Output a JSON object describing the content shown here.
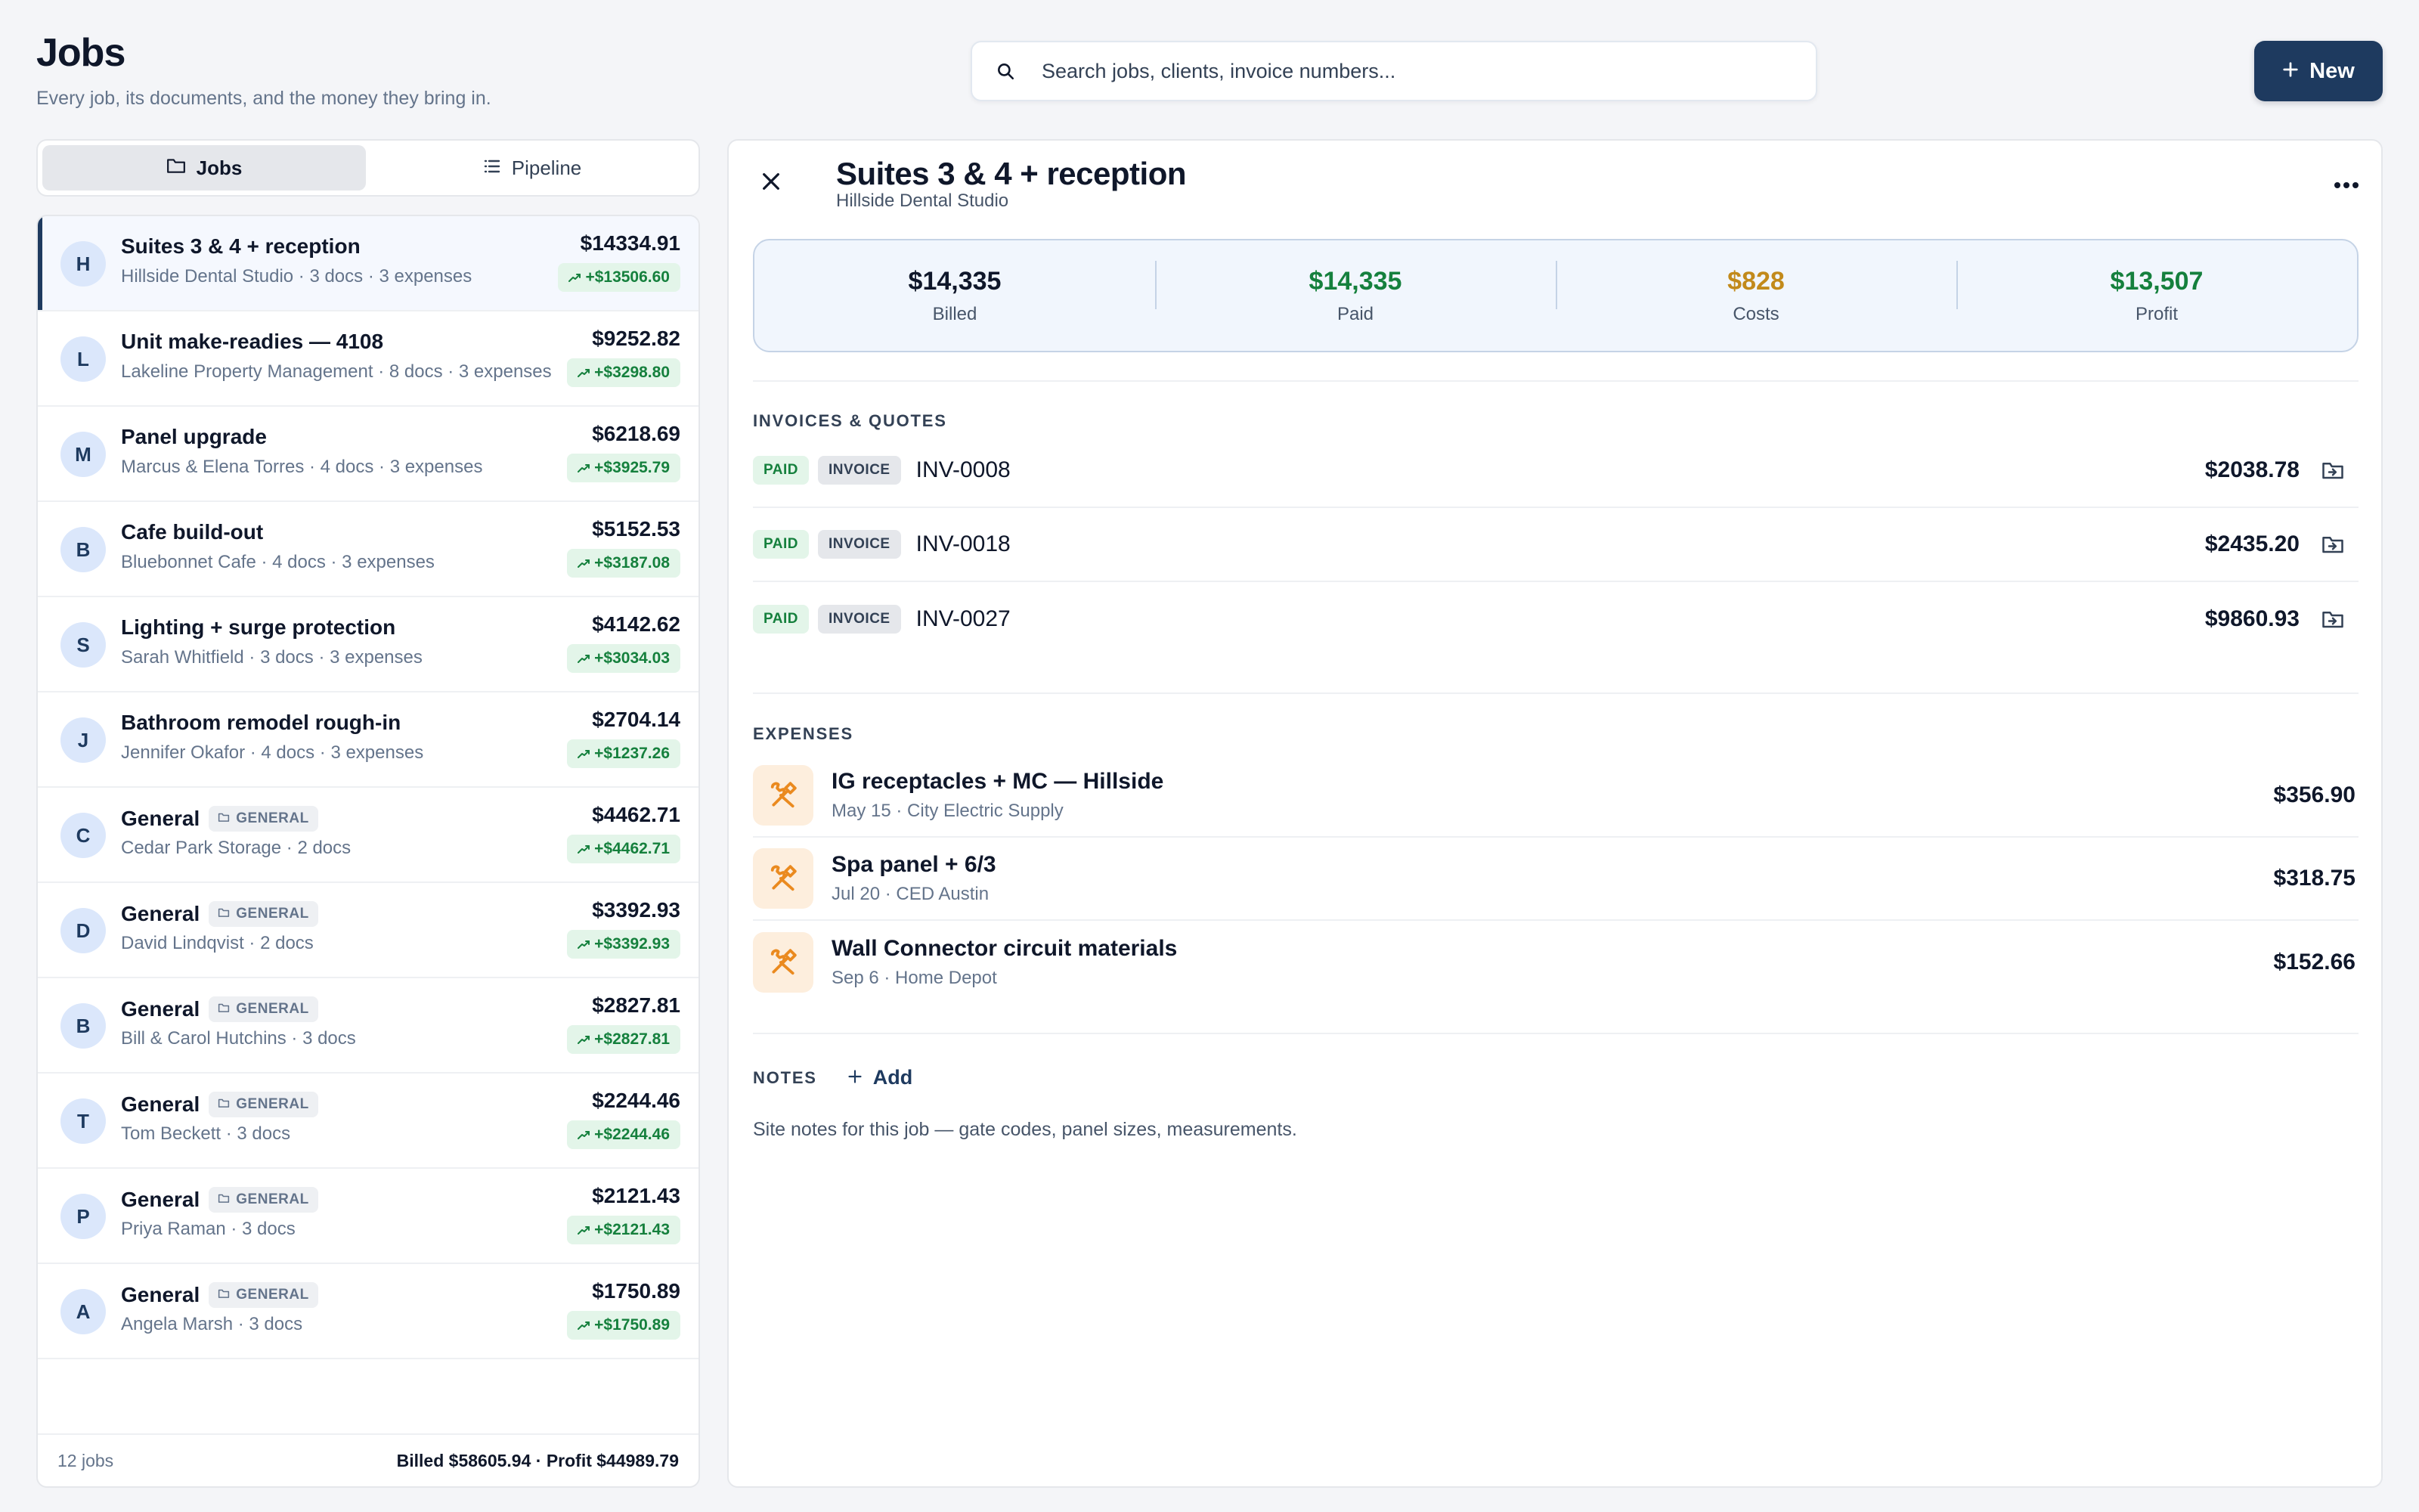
{
  "header": {
    "title": "Jobs",
    "subtitle": "Every job, its documents, and the money they bring in.",
    "search_placeholder": "Search jobs, clients, invoice numbers...",
    "new_label": "New"
  },
  "tabs": [
    {
      "label": "Jobs",
      "active": true,
      "icon": "folder-icon"
    },
    {
      "label": "Pipeline",
      "active": false,
      "icon": "list-icon"
    }
  ],
  "jobs": [
    {
      "initial": "H",
      "title": "Suites 3 & 4 + reception",
      "general": false,
      "sub": "Hillside Dental Studio · 3 docs · 3 expenses",
      "amount": "$14334.91",
      "profit": "+$13506.60",
      "selected": true
    },
    {
      "initial": "L",
      "title": "Unit make-readies — 4108",
      "general": false,
      "sub": "Lakeline Property Management · 8 docs · 3 expenses",
      "amount": "$9252.82",
      "profit": "+$3298.80"
    },
    {
      "initial": "M",
      "title": "Panel upgrade",
      "general": false,
      "sub": "Marcus & Elena Torres · 4 docs · 3 expenses",
      "amount": "$6218.69",
      "profit": "+$3925.79"
    },
    {
      "initial": "B",
      "title": "Cafe build-out",
      "general": false,
      "sub": "Bluebonnet Cafe · 4 docs · 3 expenses",
      "amount": "$5152.53",
      "profit": "+$3187.08"
    },
    {
      "initial": "S",
      "title": "Lighting + surge protection",
      "general": false,
      "sub": "Sarah Whitfield · 3 docs · 3 expenses",
      "amount": "$4142.62",
      "profit": "+$3034.03"
    },
    {
      "initial": "J",
      "title": "Bathroom remodel rough-in",
      "general": false,
      "sub": "Jennifer Okafor · 4 docs · 3 expenses",
      "amount": "$2704.14",
      "profit": "+$1237.26"
    },
    {
      "initial": "C",
      "title": "General",
      "general": true,
      "sub": "Cedar Park Storage · 2 docs",
      "amount": "$4462.71",
      "profit": "+$4462.71"
    },
    {
      "initial": "D",
      "title": "General",
      "general": true,
      "sub": "David Lindqvist · 2 docs",
      "amount": "$3392.93",
      "profit": "+$3392.93"
    },
    {
      "initial": "B",
      "title": "General",
      "general": true,
      "sub": "Bill & Carol Hutchins · 3 docs",
      "amount": "$2827.81",
      "profit": "+$2827.81"
    },
    {
      "initial": "T",
      "title": "General",
      "general": true,
      "sub": "Tom Beckett · 3 docs",
      "amount": "$2244.46",
      "profit": "+$2244.46"
    },
    {
      "initial": "P",
      "title": "General",
      "general": true,
      "sub": "Priya Raman · 3 docs",
      "amount": "$2121.43",
      "profit": "+$2121.43"
    },
    {
      "initial": "A",
      "title": "General",
      "general": true,
      "sub": "Angela Marsh · 3 docs",
      "amount": "$1750.89",
      "profit": "+$1750.89"
    }
  ],
  "general_tag": "GENERAL",
  "list_footer": {
    "count": "12 jobs",
    "totals": "Billed $58605.94 · Profit $44989.79"
  },
  "detail": {
    "title": "Suites 3 & 4 + reception",
    "client": "Hillside Dental Studio",
    "stats": [
      {
        "value": "$14,335",
        "label": "Billed",
        "color": "#0f172a"
      },
      {
        "value": "$14,335",
        "label": "Paid",
        "color": "#15803d"
      },
      {
        "value": "$828",
        "label": "Costs",
        "color": "#c28a1b"
      },
      {
        "value": "$13,507",
        "label": "Profit",
        "color": "#15803d"
      }
    ],
    "invoices_heading": "INVOICES & QUOTES",
    "invoices": [
      {
        "status": "PAID",
        "type": "INVOICE",
        "number": "INV-0008",
        "amount": "$2038.78"
      },
      {
        "status": "PAID",
        "type": "INVOICE",
        "number": "INV-0018",
        "amount": "$2435.20"
      },
      {
        "status": "PAID",
        "type": "INVOICE",
        "number": "INV-0027",
        "amount": "$9860.93"
      }
    ],
    "expenses_heading": "EXPENSES",
    "expenses": [
      {
        "name": "IG receptacles + MC — Hillside",
        "meta": "May 15 · City Electric Supply",
        "amount": "$356.90"
      },
      {
        "name": "Spa panel + 6/3",
        "meta": "Jul 20 · CED Austin",
        "amount": "$318.75"
      },
      {
        "name": "Wall Connector circuit materials",
        "meta": "Sep 6 · Home Depot",
        "amount": "$152.66"
      }
    ],
    "notes_heading": "NOTES",
    "notes_add": "Add",
    "notes_placeholder": "Site notes for this job — gate codes, panel sizes, measurements."
  }
}
